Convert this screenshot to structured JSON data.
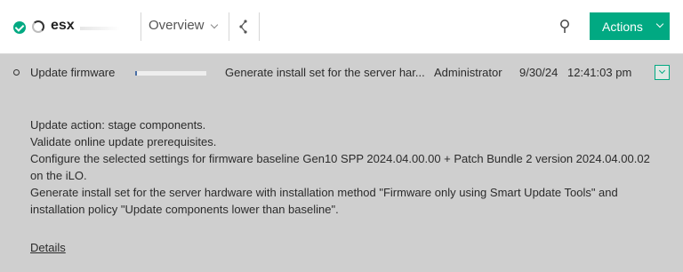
{
  "header": {
    "title": "esx",
    "view_selector": "Overview",
    "actions_label": "Actions",
    "icons": [
      "status-ok-icon",
      "spinner-icon",
      "chevron-down-icon",
      "share-icon",
      "search-icon"
    ]
  },
  "activity": {
    "name": "Update firmware",
    "progress": 0.03,
    "current_step": "Generate install set for the server har...",
    "owner": "Administrator",
    "date": "9/30/24",
    "time": "12:41:03 pm"
  },
  "details": {
    "lines": [
      "Update action: stage components.",
      "Validate online update prerequisites.",
      "Configure the selected settings for firmware baseline Gen10 SPP 2024.04.00.00 + Patch Bundle 2 version 2024.04.00.02 on the iLO.",
      "Generate install set for the server hardware with installation method \"Firmware only using Smart Update Tools\" and installation policy \"Update components lower than baseline\"."
    ],
    "link_label": "Details"
  },
  "colors": {
    "accent": "#01a982",
    "panel": "#cfcfcf",
    "header": "#ffffff"
  }
}
